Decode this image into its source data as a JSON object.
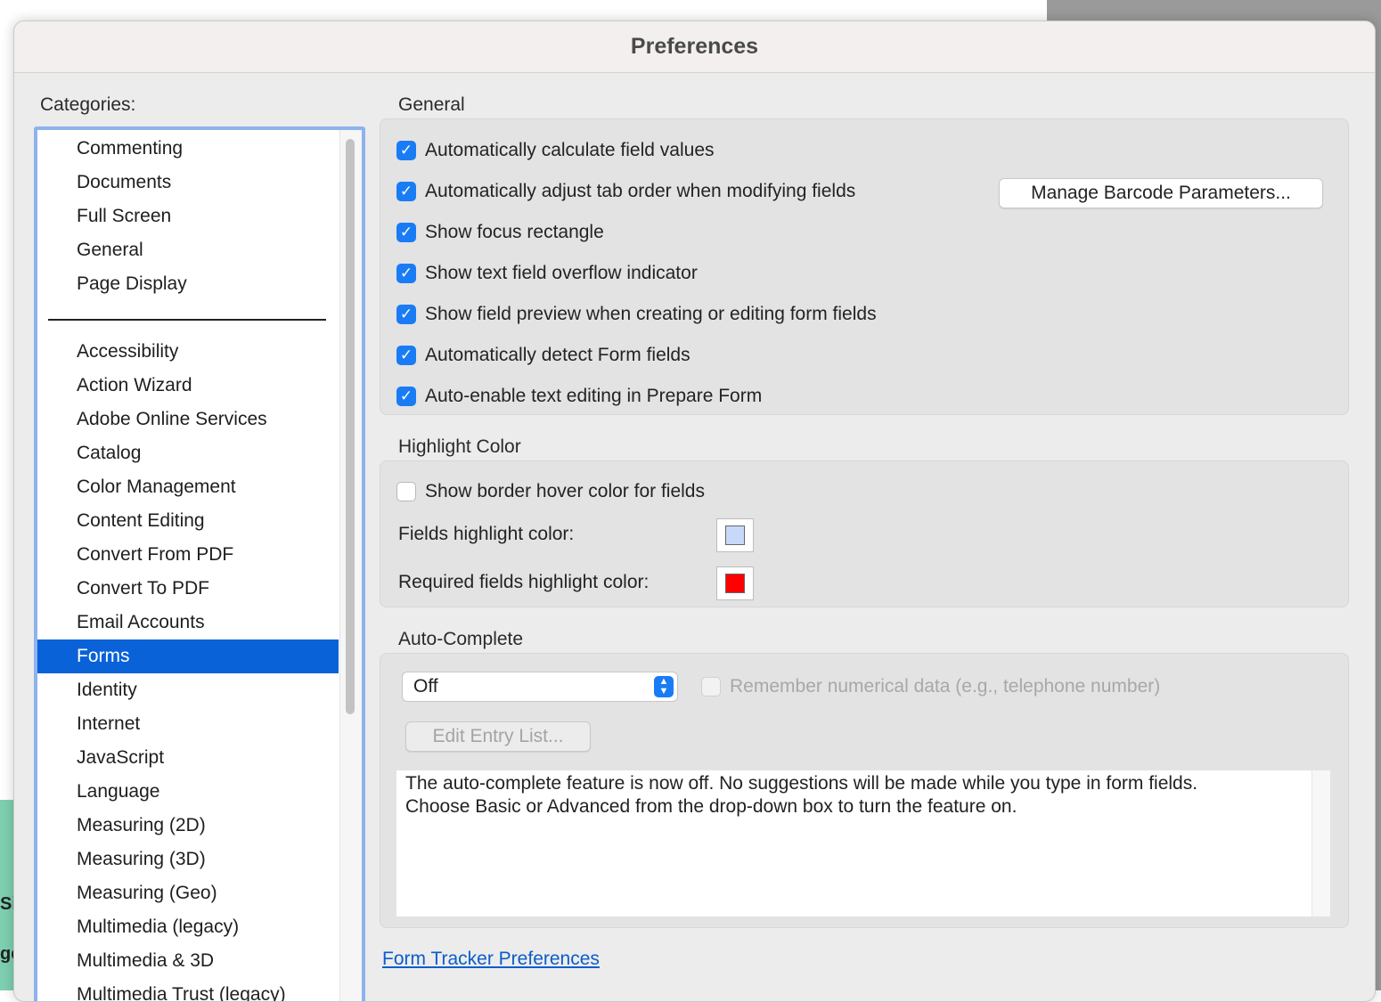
{
  "window": {
    "title": "Preferences"
  },
  "background": {
    "left_text_1": "Si",
    "left_text_2": "ge"
  },
  "categories": {
    "label": "Categories:",
    "top_items": [
      "Commenting",
      "Documents",
      "Full Screen",
      "General",
      "Page Display"
    ],
    "items": [
      "Accessibility",
      "Action Wizard",
      "Adobe Online Services",
      "Catalog",
      "Color Management",
      "Content Editing",
      "Convert From PDF",
      "Convert To PDF",
      "Email Accounts",
      "Forms",
      "Identity",
      "Internet",
      "JavaScript",
      "Language",
      "Measuring (2D)",
      "Measuring (3D)",
      "Measuring (Geo)",
      "Multimedia (legacy)",
      "Multimedia & 3D",
      "Multimedia Trust (legacy)"
    ],
    "selected": "Forms"
  },
  "general": {
    "title": "General",
    "checkboxes": [
      {
        "label": "Automatically calculate field values",
        "checked": true
      },
      {
        "label": "Automatically adjust tab order when modifying fields",
        "checked": true
      },
      {
        "label": "Show focus rectangle",
        "checked": true
      },
      {
        "label": "Show text field overflow indicator",
        "checked": true
      },
      {
        "label": "Show field preview when creating or editing form fields",
        "checked": true
      },
      {
        "label": "Automatically detect Form fields",
        "checked": true
      },
      {
        "label": "Auto-enable text editing in Prepare Form",
        "checked": true
      }
    ],
    "barcode_button": "Manage Barcode Parameters..."
  },
  "highlight": {
    "title": "Highlight Color",
    "hover_checkbox": {
      "label": "Show border hover color for fields",
      "checked": false
    },
    "fields_label": "Fields highlight color:",
    "fields_color": "#c8d8f8",
    "required_label": "Required fields highlight color:",
    "required_color": "#ff0000"
  },
  "autocomplete": {
    "title": "Auto-Complete",
    "select_value": "Off",
    "remember_checkbox": {
      "label": "Remember numerical data (e.g., telephone number)",
      "checked": false,
      "disabled": true
    },
    "edit_button": "Edit Entry List...",
    "description_line1": "The auto-complete feature is now off. No suggestions will be made while you type in form fields.",
    "description_line2": "Choose Basic or Advanced from the drop-down box to turn the feature on."
  },
  "link": {
    "label": "Form Tracker Preferences"
  },
  "colors": {
    "accent": "#1a7cf5",
    "selection": "#0962d8",
    "list_border": "#8db3ec",
    "link": "#0b5ccc"
  }
}
